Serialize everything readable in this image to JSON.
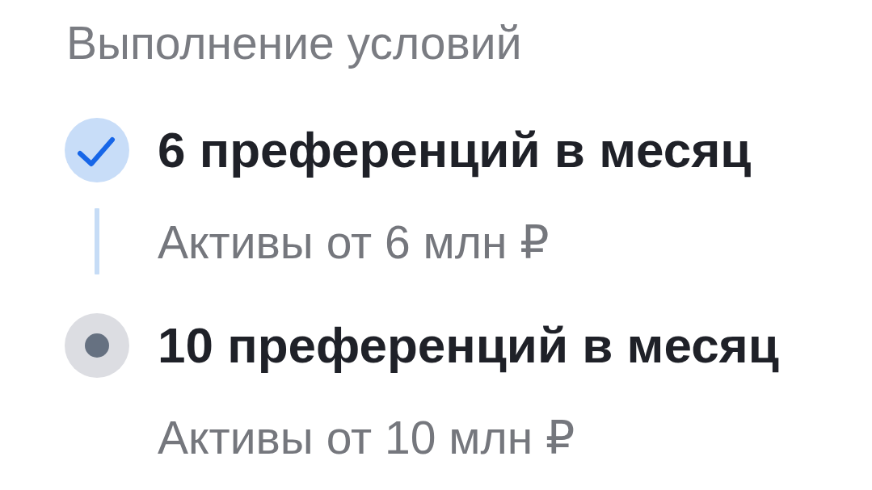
{
  "title": "Выполнение условий",
  "steps": [
    {
      "title": "6 преференций в месяц",
      "subtitle": "Активы от 6 млн ₽",
      "completed": true
    },
    {
      "title": "10 преференций в месяц",
      "subtitle": "Активы от 10 млн ₽",
      "completed": false
    }
  ]
}
